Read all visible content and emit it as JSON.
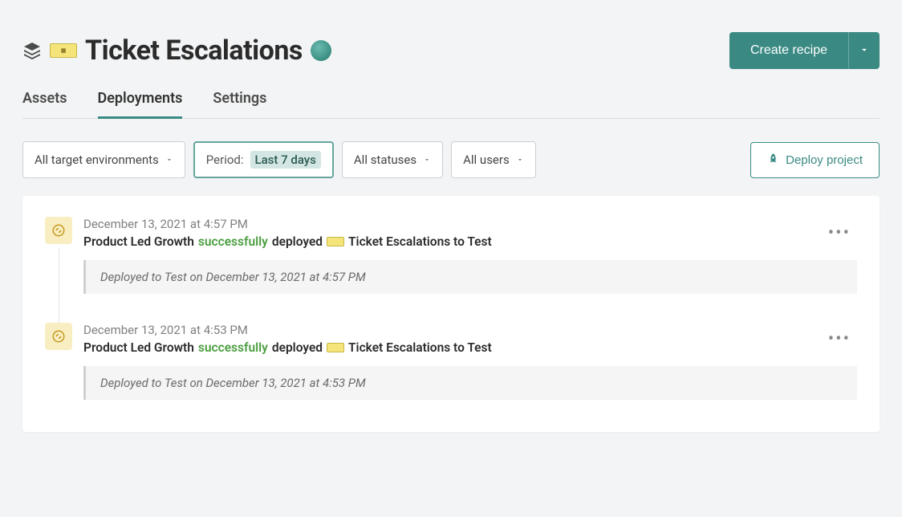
{
  "header": {
    "project_name": "Ticket Escalations",
    "create_button": "Create recipe"
  },
  "tabs": {
    "assets": "Assets",
    "deployments": "Deployments",
    "settings": "Settings",
    "active": "deployments"
  },
  "filters": {
    "env": "All target environments",
    "period_label": "Period:",
    "period_value": "Last 7 days",
    "status": "All statuses",
    "users": "All users"
  },
  "deploy_button": "Deploy project",
  "entries": [
    {
      "timestamp": "December 13, 2021 at 4:57 PM",
      "actor": "Product Led Growth",
      "status_word": "successfully",
      "verb": "deployed",
      "target": "Ticket Escalations to Test",
      "note": "Deployed to Test on December 13, 2021 at 4:57 PM"
    },
    {
      "timestamp": "December 13, 2021 at 4:53 PM",
      "actor": "Product Led Growth",
      "status_word": "successfully",
      "verb": "deployed",
      "target": "Ticket Escalations to Test",
      "note": "Deployed to Test on December 13, 2021 at 4:53 PM"
    }
  ]
}
